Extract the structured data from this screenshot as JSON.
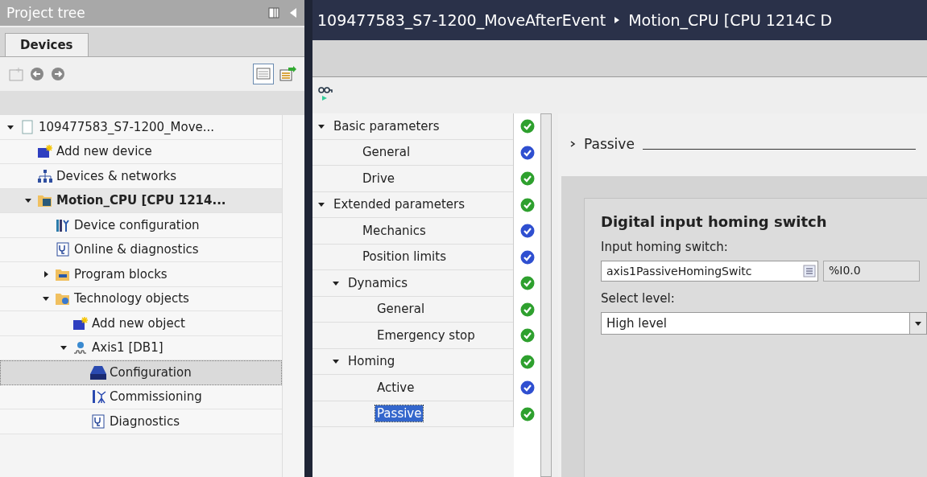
{
  "project_tree": {
    "title": "Project tree",
    "tabs": [
      {
        "label": "Devices",
        "selected": true
      }
    ],
    "items": [
      {
        "label": "109477583_S7-1200_Move...",
        "kind": "project",
        "expanded": true,
        "selected": false,
        "bold": false,
        "children": [
          {
            "label": "Add new device",
            "kind": "add",
            "selected": false,
            "bold": false
          },
          {
            "label": "Devices & networks",
            "kind": "network",
            "selected": false,
            "bold": false
          },
          {
            "label": "Motion_CPU [CPU 1214...",
            "kind": "cpu",
            "expanded": true,
            "selected": false,
            "bold": true,
            "children": [
              {
                "label": "Device configuration",
                "kind": "devconfig",
                "selected": false,
                "bold": false
              },
              {
                "label": "Online & diagnostics",
                "kind": "diag",
                "selected": false,
                "bold": false
              },
              {
                "label": "Program blocks",
                "kind": "folder",
                "expanded": false,
                "selected": false,
                "bold": false
              },
              {
                "label": "Technology objects",
                "kind": "techfolder",
                "expanded": true,
                "selected": false,
                "bold": false,
                "children": [
                  {
                    "label": "Add new object",
                    "kind": "add",
                    "selected": false,
                    "bold": false
                  },
                  {
                    "label": "Axis1 [DB1]",
                    "kind": "axis",
                    "expanded": true,
                    "selected": false,
                    "bold": false,
                    "children": [
                      {
                        "label": "Configuration",
                        "kind": "config",
                        "selected": true,
                        "bold": false
                      },
                      {
                        "label": "Commissioning",
                        "kind": "commission",
                        "selected": false,
                        "bold": false
                      },
                      {
                        "label": "Diagnostics",
                        "kind": "diag",
                        "selected": false,
                        "bold": false
                      }
                    ]
                  }
                ]
              }
            ]
          }
        ]
      }
    ]
  },
  "editor": {
    "breadcrumb": [
      "109477583_S7-1200_MoveAfterEvent",
      "Motion_CPU [CPU 1214C D"
    ],
    "nav": [
      {
        "label": "Basic parameters",
        "expanded": true,
        "selected": false,
        "color": "#2ea02e",
        "children": [
          {
            "label": "General",
            "selected": false,
            "color": "#2f4fd0"
          },
          {
            "label": "Drive",
            "selected": false,
            "color": "#2ea02e"
          }
        ]
      },
      {
        "label": "Extended parameters",
        "expanded": true,
        "selected": false,
        "color": "#2ea02e",
        "children": [
          {
            "label": "Mechanics",
            "selected": false,
            "color": "#2f4fd0"
          },
          {
            "label": "Position limits",
            "selected": false,
            "color": "#2f4fd0"
          },
          {
            "label": "Dynamics",
            "expanded": true,
            "selected": false,
            "color": "#2ea02e",
            "children": [
              {
                "label": "General",
                "selected": false,
                "color": "#2ea02e"
              },
              {
                "label": "Emergency stop",
                "selected": false,
                "color": "#2ea02e"
              }
            ]
          },
          {
            "label": "Homing",
            "expanded": true,
            "selected": false,
            "color": "#2ea02e",
            "children": [
              {
                "label": "Active",
                "selected": false,
                "color": "#2f4fd0"
              },
              {
                "label": "Passive",
                "selected": true,
                "color": "#2ea02e"
              }
            ]
          }
        ]
      }
    ],
    "section_title": "Passive",
    "group_title": "Digital input homing switch",
    "input_label": "Input homing switch:",
    "input_value": "axis1PassiveHomingSwitc",
    "address": "%I0.0",
    "level_label": "Select level:",
    "level_value": "High level"
  }
}
